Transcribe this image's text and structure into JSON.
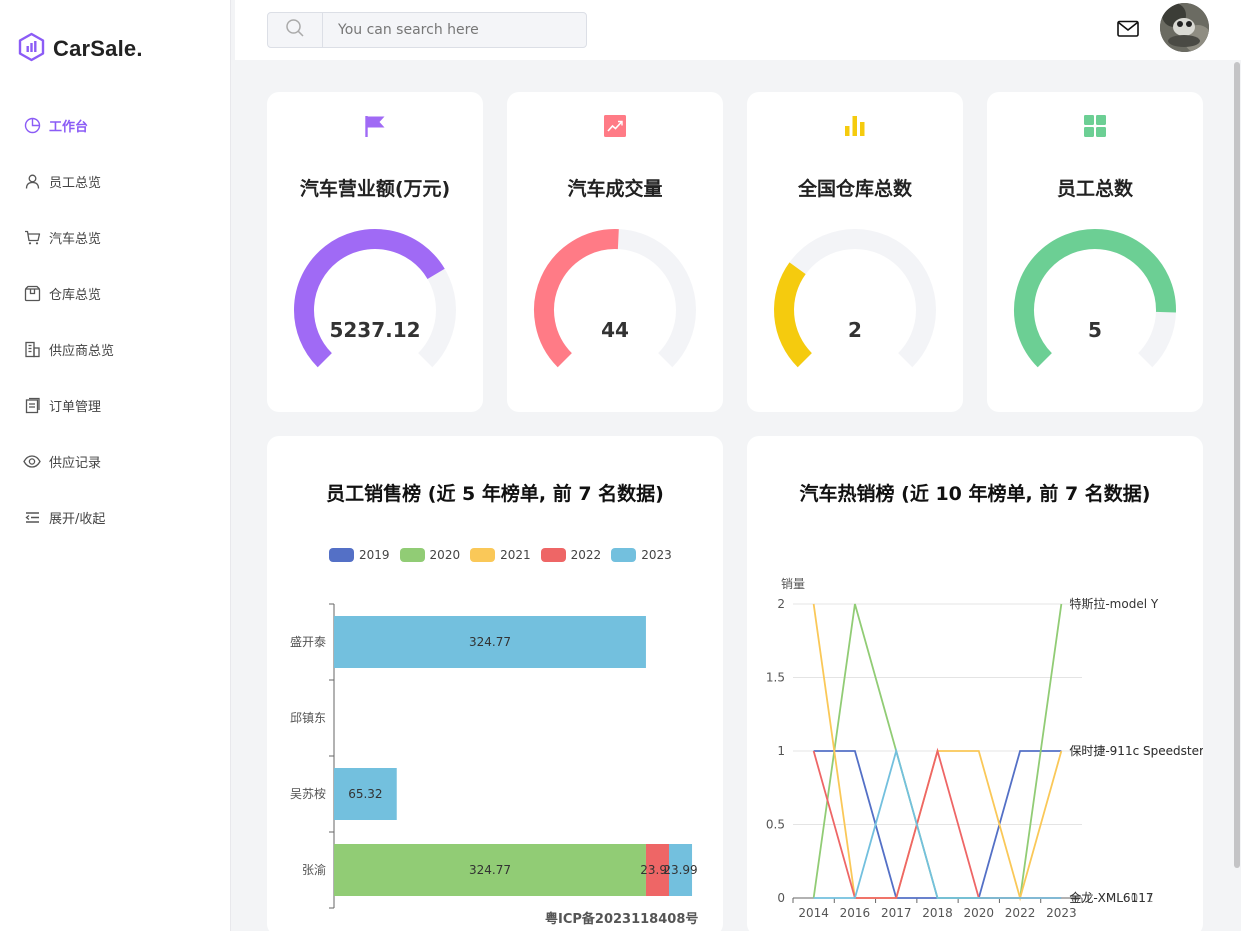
{
  "brand": {
    "name": "CarSale."
  },
  "sidebar": {
    "items": [
      {
        "label": "工作台",
        "icon": "pie-chart-icon",
        "active": true
      },
      {
        "label": "员工总览",
        "icon": "user-icon",
        "active": false
      },
      {
        "label": "汽车总览",
        "icon": "cart-icon",
        "active": false
      },
      {
        "label": "仓库总览",
        "icon": "box-icon",
        "active": false
      },
      {
        "label": "供应商总览",
        "icon": "building-icon",
        "active": false
      },
      {
        "label": "订单管理",
        "icon": "orders-icon",
        "active": false
      },
      {
        "label": "供应记录",
        "icon": "eye-icon",
        "active": false
      },
      {
        "label": "展开/收起",
        "icon": "collapse-icon",
        "active": false
      }
    ]
  },
  "header": {
    "search_placeholder": "You can search here"
  },
  "colors": {
    "accent": "#8b5cf6",
    "revenue": "#a06af5",
    "volume": "#ff7b86",
    "warehouse": "#f5cb0e",
    "staff": "#6ccf94",
    "track": "#f3f4f7"
  },
  "stats": [
    {
      "title": "汽车营业额(万元)",
      "value": "5237.12",
      "fill": 0.72,
      "icon": "flag-icon",
      "color": "#a06af5"
    },
    {
      "title": "汽车成交量",
      "value": "44",
      "fill": 0.51,
      "icon": "trend-chart-icon",
      "color": "#ff7b86"
    },
    {
      "title": "全国仓库总数",
      "value": "2",
      "fill": 0.3,
      "icon": "bar-chart-icon",
      "color": "#f5cb0e"
    },
    {
      "title": "员工总数",
      "value": "5",
      "fill": 0.84,
      "icon": "grid-icon",
      "color": "#6ccf94"
    }
  ],
  "chart_data": [
    {
      "type": "bar",
      "orientation": "horizontal",
      "stacked": true,
      "title": "员工销售榜 (近 5 年榜单, 前 7 名数据)",
      "categories": [
        "盛开泰",
        "邱镇东",
        "吴苏桉",
        "张渝"
      ],
      "legend_position": "top",
      "series": [
        {
          "name": "2019",
          "color": "#5470c6",
          "values": [
            0,
            0,
            0,
            0
          ]
        },
        {
          "name": "2020",
          "color": "#91cc75",
          "values": [
            0,
            0,
            0,
            324.77
          ]
        },
        {
          "name": "2021",
          "color": "#fac858",
          "values": [
            0,
            0,
            0,
            0
          ]
        },
        {
          "name": "2022",
          "color": "#ee6666",
          "values": [
            0,
            0,
            0,
            23.99
          ]
        },
        {
          "name": "2023",
          "color": "#73c0de",
          "values": [
            324.77,
            0,
            65.32,
            23.99
          ]
        }
      ],
      "data_labels": [
        "324.77",
        "65.32",
        "324.77",
        "23.99",
        "23.99"
      ],
      "xlim": [
        0,
        380
      ]
    },
    {
      "type": "line",
      "title": "汽车热销榜 (近 10 年榜单, 前 7 名数据)",
      "ylabel": "销量",
      "x": [
        "2014",
        "2016",
        "2017",
        "2018",
        "2020",
        "2022",
        "2023"
      ],
      "ylim": [
        0,
        2
      ],
      "yticks": [
        "0",
        "0.5",
        "1",
        "1.5",
        "2"
      ],
      "grid": true,
      "end_labels": [
        "特斯拉-model Y",
        "保时捷-911c Speedster",
        "金龙-XML6117",
        "全龙-XML6011",
        "保时捷-911c Speedster"
      ],
      "series": [
        {
          "color": "#5470c6",
          "values": [
            1,
            1,
            0,
            0,
            0,
            1,
            1
          ]
        },
        {
          "color": "#91cc75",
          "values": [
            0,
            2,
            1,
            0,
            0,
            0,
            2
          ]
        },
        {
          "color": "#fac858",
          "values": [
            2,
            0,
            0,
            1,
            1,
            0,
            1
          ]
        },
        {
          "color": "#ee6666",
          "values": [
            1,
            0,
            0,
            1,
            0,
            0,
            0
          ]
        },
        {
          "color": "#73c0de",
          "values": [
            0,
            0,
            1,
            0,
            0,
            0,
            0
          ]
        }
      ]
    }
  ],
  "footer": {
    "icp": "粤ICP备2023118408号"
  }
}
